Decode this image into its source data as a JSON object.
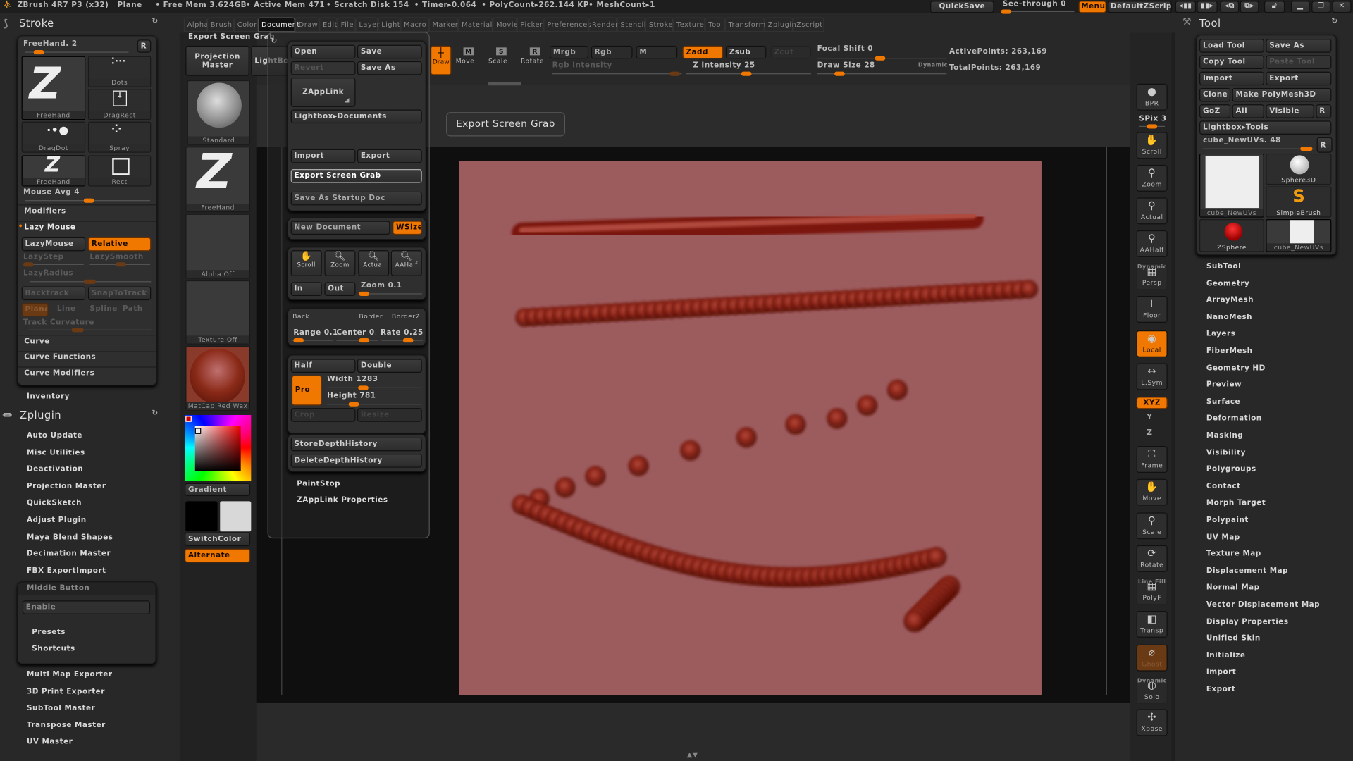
{
  "titlebar": {
    "app": "ZBrush 4R7 P3 (x32)",
    "doc": "Plane",
    "free_mem": "• Free Mem 3.624GB",
    "active_mem": "• Active Mem 471",
    "scratch": "• Scratch Disk 154",
    "timer": "• Timer▸0.064",
    "polycount": "• PolyCount▸262.144 KP",
    "meshcount": "• MeshCount▸1",
    "quicksave": "QuickSave",
    "see_through": "See-through  0",
    "see_through_value": 0,
    "menus": "Menus",
    "script": "DefaultZScript"
  },
  "menubar": [
    "Alpha",
    "Brush",
    "Color",
    "Document",
    "Draw",
    "Edit",
    "File",
    "Layer",
    "Light",
    "Macro",
    "Marker",
    "Material",
    "Movie",
    "Picker",
    "Preferences",
    "Render",
    "Stencil",
    "Stroke",
    "Texture",
    "Tool",
    "Transform",
    "Zplugin",
    "Zscript"
  ],
  "menubar_active": "Document",
  "stroke_panel": {
    "title": "Stroke",
    "current": "FreeHand. 2",
    "r": "R",
    "thumbs": [
      "FreeHand",
      "Dots",
      "DragRect",
      "DragDot",
      "Spray",
      "FreeHand",
      "Rect"
    ],
    "mouse_avg": "Mouse  Avg 4",
    "modifiers": "Modifiers",
    "lazy_mouse": "Lazy Mouse",
    "lazymouse_btn": "LazyMouse",
    "relative": "Relative",
    "lazystep": "LazyStep",
    "lazysmooth": "LazySmooth",
    "lazyradius": "LazyRadius",
    "backtrack": "Backtrack",
    "snaptotrack": "SnapToTrack",
    "plane": "Plane",
    "line": "Line",
    "spline": "Spline",
    "path": "Path",
    "track_curvature": "Track  Curvature",
    "curve": "Curve",
    "curve_functions": "Curve  Functions",
    "curve_modifiers": "Curve  Modifiers"
  },
  "inventory": "Inventory",
  "zplugin": {
    "title": "Zplugin",
    "items": [
      "Auto  Update",
      "Misc  Utilities",
      "Deactivation",
      "Projection  Master",
      "QuickSketch",
      "Adjust  Plugin",
      "Maya  Blend  Shapes",
      "Decimation  Master",
      "FBX  ExportImport"
    ],
    "middle_button": {
      "title": "Middle  Button",
      "enable": "Enable",
      "presets": "Presets",
      "shortcuts": "Shortcuts"
    },
    "items2": [
      "Multi  Map  Exporter",
      "3D  Print  Exporter",
      "SubTool  Master",
      "Transpose  Master",
      "UV  Master"
    ]
  },
  "left_shelf": {
    "tooltip_label": "Export Screen Grab",
    "projection_master": "Projection Master",
    "lightbox": "LightBox",
    "thumbs": [
      "Standard",
      "FreeHand",
      "Alpha  Off",
      "Texture  Off",
      "MatCap  Red  Wax"
    ],
    "gradient": "Gradient",
    "switchcolor": "SwitchColor",
    "alternate": "Alternate",
    "main_color": "#000000",
    "secondary_color": "#d8d8d8"
  },
  "document_menu": {
    "open": "Open",
    "save": "Save",
    "revert": "Revert",
    "save_as": "Save  As",
    "zapplink": "ZAppLink",
    "lightbox_docs": "Lightbox▸Documents",
    "import": "Import",
    "export": "Export",
    "export_screen_grab": "Export  Screen  Grab",
    "save_startup": "Save  As  Startup  Doc",
    "new_document": "New  Document",
    "wsize": "WSize",
    "scroll": "Scroll",
    "zoom": "Zoom",
    "actual": "Actual",
    "aahalf": "AAHalf",
    "in": "In",
    "out": "Out",
    "zoom_value": "Zoom 0.1",
    "back": "Back",
    "border": "Border",
    "border2": "Border2",
    "range": "Range 0.1",
    "center": "Center 0.7",
    "rate": "Rate 0.25",
    "half": "Half",
    "double": "Double",
    "pro": "Pro",
    "width": "Width 1283",
    "height": "Height 781",
    "crop": "Crop",
    "resize": "Resize",
    "store_depth": "StoreDepthHistory",
    "delete_depth": "DeleteDepthHistory",
    "paintstop": "PaintStop",
    "zapplink_props": "ZAppLink  Properties"
  },
  "tooltip": "Export Screen Grab",
  "toolbar": {
    "draw": "Draw",
    "move": "Move",
    "scale": "Scale",
    "rotate": "Rotate",
    "mrgb": "Mrgb",
    "rgb": "Rgb",
    "m": "M",
    "rgb_intensity": "Rgb  Intensity",
    "zadd": "Zadd",
    "zsub": "Zsub",
    "zcut": "Zcut",
    "z_intensity": "Z  Intensity 25",
    "focal_shift": "Focal  Shift 0",
    "draw_size": "Draw  Size 28",
    "dynamic": "Dynamic",
    "active_points": "ActivePoints: 263,169",
    "total_points": "TotalPoints: 263,169"
  },
  "right_shelf": [
    {
      "label": "BPR",
      "icon": "bpr-sphere-icon"
    },
    {
      "label": "SPix 3"
    },
    {
      "label": "Scroll",
      "icon": "hand-icon"
    },
    {
      "label": "Zoom",
      "icon": "magnifier-icon"
    },
    {
      "label": "Actual",
      "icon": "magnifier-x1-icon"
    },
    {
      "label": "AAHalf",
      "icon": "magnifier-half-icon"
    },
    {
      "label": "Persp",
      "top": "Dynamic",
      "icon": "grid-icon"
    },
    {
      "label": "Floor",
      "icon": "floor-icon"
    },
    {
      "label": "Local",
      "icon": "local-icon"
    },
    {
      "label": "L.Sym",
      "icon": "symmetry-icon"
    },
    {
      "label": "XYZ",
      "icon": "rotate-xyz-icon"
    },
    {
      "label": "Y"
    },
    {
      "label": "Z"
    },
    {
      "label": "Frame",
      "icon": "frame-icon"
    },
    {
      "label": "Move",
      "icon": "move-icon"
    },
    {
      "label": "Scale",
      "icon": "scale-icon"
    },
    {
      "label": "Rotate",
      "icon": "rotate-icon"
    },
    {
      "label": "PolyF",
      "top": "Line Fill",
      "icon": "polyframe-icon"
    },
    {
      "label": "Transp",
      "icon": "transparency-icon"
    },
    {
      "label": "Ghost",
      "icon": "ghost-icon"
    },
    {
      "label": "Solo",
      "top": "Dynamic",
      "icon": "solo-icon"
    },
    {
      "label": "Xpose",
      "icon": "xpose-icon"
    }
  ],
  "tool_panel": {
    "title": "Tool",
    "load": "Load  Tool",
    "save_as": "Save  As",
    "copy": "Copy  Tool",
    "paste": "Paste  Tool",
    "import": "Import",
    "export": "Export",
    "clone": "Clone",
    "make_polymesh": "Make  PolyMesh3D",
    "goz": "GoZ",
    "all": "All",
    "visible": "Visible",
    "r": "R",
    "lightbox_tools": "Lightbox▸Tools",
    "current": "cube_NewUVs. 48",
    "thumbs": [
      "cube_NewUVs",
      "Sphere3D",
      "SimpleBrush",
      "ZSphere",
      "cube_NewUVs"
    ],
    "items": [
      "SubTool",
      "Geometry",
      "ArrayMesh",
      "NanoMesh",
      "Layers",
      "FiberMesh",
      "Geometry  HD",
      "Preview",
      "Surface",
      "Deformation",
      "Masking",
      "Visibility",
      "Polygroups",
      "Contact",
      "Morph  Target",
      "Polypaint",
      "UV  Map",
      "Texture  Map",
      "Displacement  Map",
      "Normal  Map",
      "Vector  Displacement  Map",
      "Display  Properties",
      "Unified  Skin",
      "Initialize",
      "Import",
      "Export"
    ]
  },
  "colors": {
    "accent": "#f07800",
    "canvas_doc": "#9c5b5d",
    "stroke": "#7a1810"
  }
}
